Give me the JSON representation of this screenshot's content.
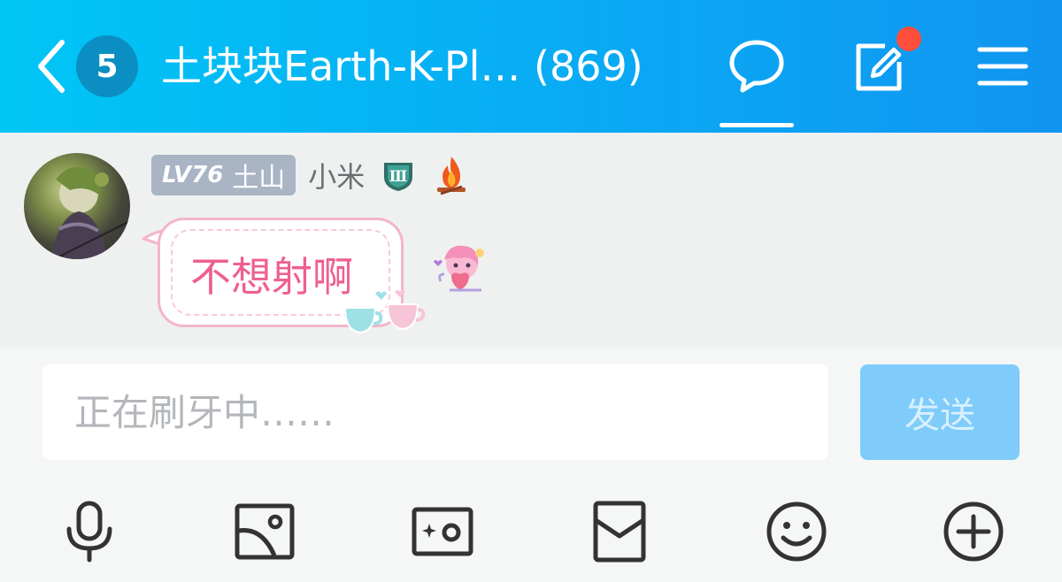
{
  "header": {
    "unread_count": "5",
    "title": "土块块Earth-K-Pl… (869)",
    "icons": [
      "chevron-left-icon",
      "chat-bubble-icon",
      "edit-icon",
      "menu-icon"
    ],
    "gradient": [
      "#00c6f5",
      "#1195f0"
    ],
    "notification_dot_color": "#ff4e3a"
  },
  "message": {
    "level": "LV76",
    "title_tag": "土山",
    "nickname": "小米",
    "rank_badge": "Ⅲ",
    "text": "不想射啊",
    "text_color": "#ee5f91",
    "bubble_border_color": "#f4b4cd"
  },
  "input": {
    "placeholder": "正在刷牙中……",
    "send_label": "发送",
    "send_color": "#7fccfa"
  },
  "toolbar": {
    "items": [
      "microphone-icon",
      "image-icon",
      "camera-icon",
      "red-packet-icon",
      "emoji-icon",
      "plus-icon"
    ]
  }
}
